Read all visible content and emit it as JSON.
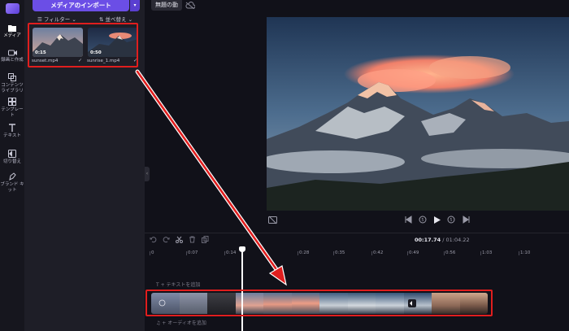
{
  "app": {
    "project_title": "無題の動"
  },
  "rail": {
    "items": [
      {
        "label": "メディア",
        "icon": "media-icon",
        "active": true
      },
      {
        "label": "録画と作成",
        "icon": "camera-icon",
        "active": false
      },
      {
        "label": "コンテンツライブラリ",
        "icon": "library-icon",
        "active": false
      },
      {
        "label": "テンプレート",
        "icon": "template-icon",
        "active": false
      },
      {
        "label": "テキスト",
        "icon": "text-icon",
        "active": false
      },
      {
        "label": "切り替え",
        "icon": "transition-icon",
        "active": false
      },
      {
        "label": "ブランド キット",
        "icon": "brand-kit-icon",
        "active": false
      }
    ]
  },
  "media_panel": {
    "import_label": "メディアのインポート",
    "filter_label": "フィルター",
    "sort_label": "並べ替え",
    "clips": [
      {
        "name": "sunset.mp4",
        "duration": "0:15",
        "check": "✓"
      },
      {
        "name": "sunrise_1.mp4",
        "duration": "0:50",
        "check": "✓"
      }
    ]
  },
  "timeline": {
    "current_time": "00:17.74",
    "separator": " / ",
    "total_time": "01:04.22",
    "ruler": [
      "0",
      "0:07",
      "0:14",
      "0:21",
      "0:28",
      "0:35",
      "0:42",
      "0:49",
      "0:56",
      "1:03",
      "1:10"
    ],
    "text_track_label": "テキストを追加",
    "audio_track_label": "オーディオを追加"
  },
  "colors": {
    "accent": "#6b4ee6",
    "annotation": "#e01e1e",
    "background": "#111119"
  }
}
